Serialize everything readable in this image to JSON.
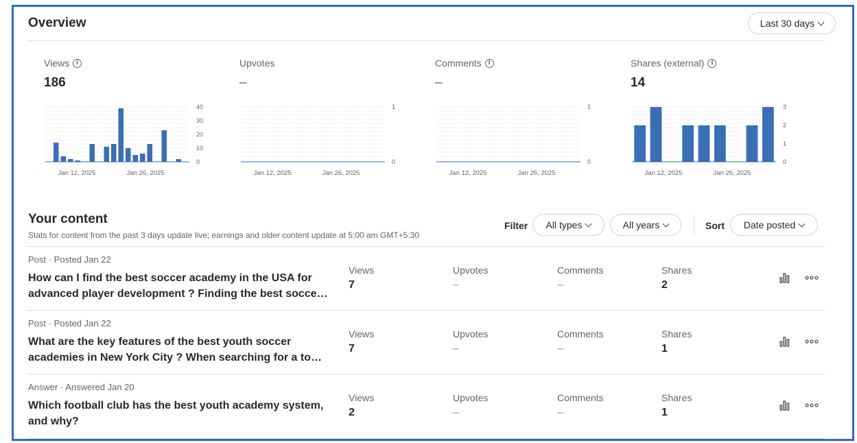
{
  "overview": {
    "title": "Overview",
    "range_label": "Last 30 days",
    "metrics": [
      {
        "label": "Views",
        "has_info": true,
        "value": "186",
        "chart_data": {
          "type": "bar",
          "x_ticks": [
            "Jan 12, 2025",
            "Jan 26, 2025"
          ],
          "y_ticks": [
            "40",
            "30",
            "20",
            "10",
            "0"
          ],
          "ylim": [
            0,
            40
          ],
          "values": [
            0,
            14,
            4,
            2,
            1,
            0,
            13,
            0,
            11,
            13,
            39,
            10,
            5,
            6,
            13,
            0,
            23,
            0,
            2,
            0
          ],
          "color": "#3a6fb4"
        }
      },
      {
        "label": "Upvotes",
        "has_info": false,
        "value": "–",
        "chart_data": {
          "type": "bar",
          "x_ticks": [
            "Jan 12, 2025",
            "Jan 26, 2025"
          ],
          "y_ticks": [
            "1",
            "0"
          ],
          "ylim": [
            0,
            1
          ],
          "values": [],
          "color": "#3a6fb4"
        }
      },
      {
        "label": "Comments",
        "has_info": true,
        "value": "–",
        "chart_data": {
          "type": "bar",
          "x_ticks": [
            "Jan 12, 2025",
            "Jan 26, 2025"
          ],
          "y_ticks": [
            "1",
            "0"
          ],
          "ylim": [
            0,
            1
          ],
          "values": [],
          "color": "#3a6fb4"
        }
      },
      {
        "label": "Shares (external)",
        "has_info": true,
        "value": "14",
        "chart_data": {
          "type": "bar",
          "x_ticks": [
            "Jan 12, 2025",
            "Jan 26, 2025"
          ],
          "y_ticks": [
            "3",
            "2",
            "1",
            "0"
          ],
          "ylim": [
            0,
            3
          ],
          "values": [
            2,
            3,
            0,
            2,
            2,
            2,
            0,
            2,
            3
          ],
          "color": "#3a6fb4"
        }
      }
    ]
  },
  "content": {
    "title": "Your content",
    "subtitle": "Stats for content from the past 3 days update live; earnings and older content update at 5:00 am GMT+5:30",
    "filter_label": "Filter",
    "filter_type": "All types",
    "filter_year": "All years",
    "sort_label": "Sort",
    "sort_value": "Date posted",
    "stat_labels": {
      "views": "Views",
      "upvotes": "Upvotes",
      "comments": "Comments",
      "shares": "Shares"
    },
    "rows": [
      {
        "meta": "Post · Posted Jan 22",
        "title": "How can I find the best soccer academy in the USA for advanced player development ? Finding the best socce…",
        "views": "7",
        "upvotes": "–",
        "comments": "–",
        "shares": "2"
      },
      {
        "meta": "Post · Posted Jan 22",
        "title": "What are the key features of the best youth soccer academies in New York City ? When searching for a to…",
        "views": "7",
        "upvotes": "–",
        "comments": "–",
        "shares": "1"
      },
      {
        "meta": "Answer · Answered Jan 20",
        "title": "Which football club has the best youth academy system, and why?",
        "views": "2",
        "upvotes": "–",
        "comments": "–",
        "shares": "1"
      }
    ]
  }
}
